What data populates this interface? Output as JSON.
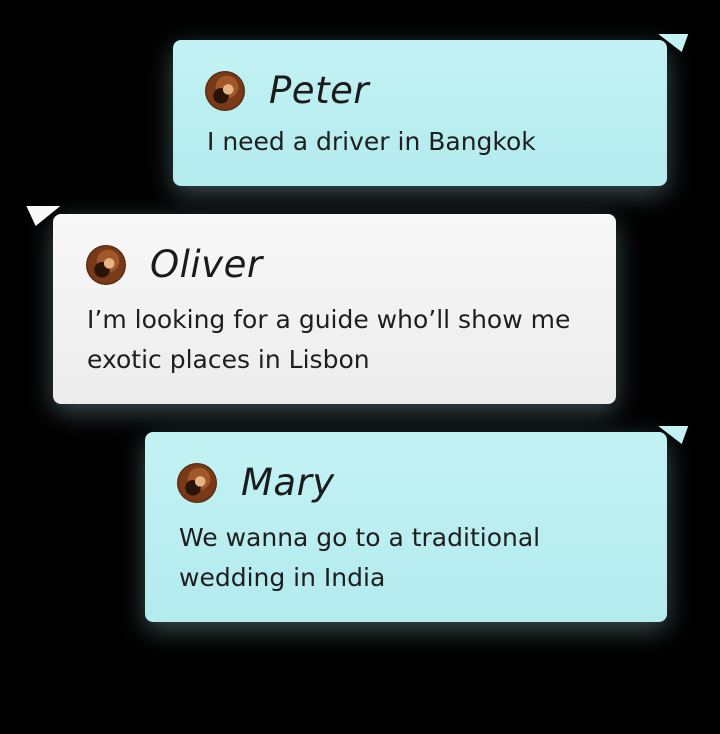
{
  "messages": [
    {
      "name": "Peter",
      "text": "I need a driver in Bangkok",
      "style": "teal",
      "avatar_icon": "user-avatar-photo"
    },
    {
      "name": "Oliver",
      "text": "I’m looking for a guide who’ll show me\nexotic places in Lisbon",
      "style": "gray",
      "avatar_icon": "user-avatar-photo"
    },
    {
      "name": "Mary",
      "text": "We wanna go to a traditional\nwedding in India",
      "style": "teal",
      "avatar_icon": "user-avatar-photo"
    }
  ],
  "colors": {
    "background": "#000000",
    "teal_bubble": "#bff0f2",
    "gray_bubble": "#f2f2f2",
    "text": "#1e1e1e"
  }
}
